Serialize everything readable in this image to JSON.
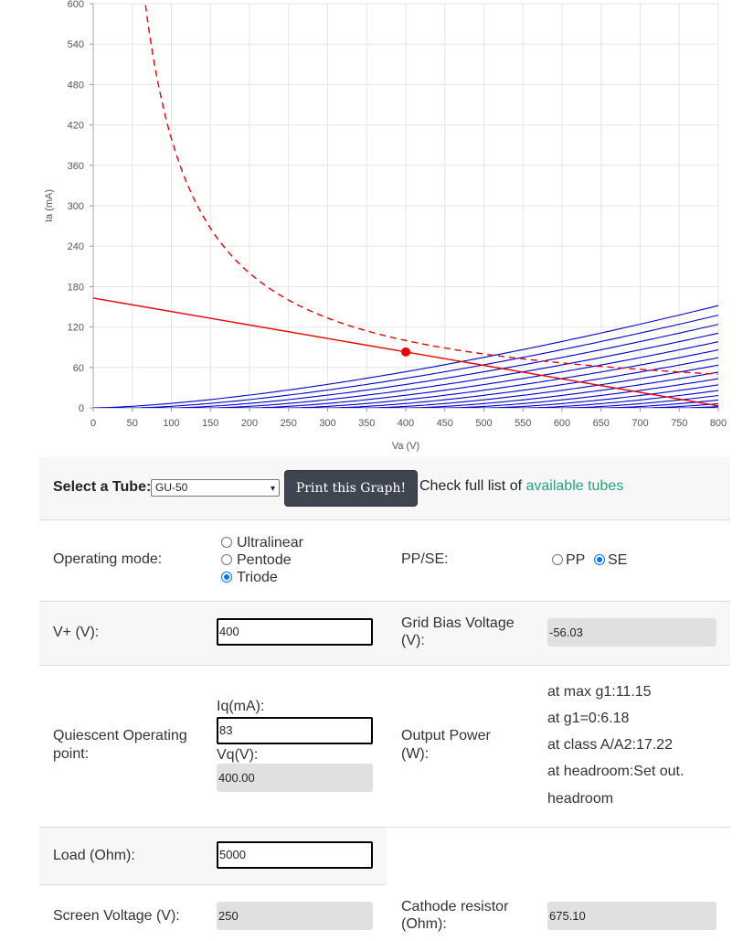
{
  "chart_data": {
    "type": "line",
    "xlabel": "Va (V)",
    "ylabel": "Ia (mA)",
    "xlim": [
      0,
      800
    ],
    "ylim": [
      0,
      600
    ],
    "x_ticks": [
      "0",
      "50",
      "100",
      "150",
      "200",
      "250",
      "300",
      "350",
      "400",
      "450",
      "500",
      "550",
      "600",
      "650",
      "700",
      "750",
      "800"
    ],
    "y_ticks": [
      "0",
      "60",
      "120",
      "180",
      "240",
      "300",
      "360",
      "420",
      "480",
      "540",
      "600"
    ],
    "grid": true,
    "curve_color": "#0000cc",
    "load_line": {
      "color": "#ee0000",
      "points": [
        [
          0,
          163
        ],
        [
          800,
          3
        ]
      ]
    },
    "max_dissipation": {
      "color": "#ee0000",
      "style": "dashed",
      "watts": 40
    },
    "operating_point": {
      "va": 400,
      "ia": 83,
      "color": "#ee0000"
    },
    "grid_curves": {
      "count": 46,
      "mu": 7.2,
      "bias_start": 0,
      "bias_step": -7
    }
  },
  "selector": {
    "label": "Select a Tube:",
    "tube_value": "GU-50",
    "caret": "▾",
    "print_button": "Print this Graph!",
    "check_text": "Check full list of ",
    "available_link": "available tubes"
  },
  "mode": {
    "label": "Operating mode:",
    "options": [
      "Ultralinear",
      "Pentode",
      "Triode"
    ],
    "selected": "Triode",
    "ppse_label": "PP/SE:",
    "pp_label": "PP",
    "se_label": "SE",
    "ppse_selected": "SE"
  },
  "vplus": {
    "label": "V+ (V):",
    "value": "400",
    "grid_bias_label_1": "Grid Bias Voltage",
    "grid_bias_label_2": "(V):",
    "grid_bias_value": "-56.03"
  },
  "quiescent": {
    "label_1": "Quiescent Operating",
    "label_2": "point:",
    "iq_label": "Iq(mA):",
    "iq_value": "83",
    "vq_label": "Vq(V):",
    "vq_value": "400.00",
    "output_label_1": "Output Power",
    "output_label_2": "(W):",
    "out_max_g1": "at max g1:11.15",
    "out_g1_zero": "at g1=0:6.18",
    "out_class": "at class A/A2:17.22",
    "out_headroom_1": "at headroom:Set out.",
    "out_headroom_2": "headroom"
  },
  "load": {
    "label": "Load (Ohm):",
    "value": "5000"
  },
  "screen": {
    "label": "Screen Voltage (V):",
    "value": "250",
    "cathode_label_1": "Cathode resistor",
    "cathode_label_2": "(Ohm):",
    "cathode_value": "675.10"
  }
}
